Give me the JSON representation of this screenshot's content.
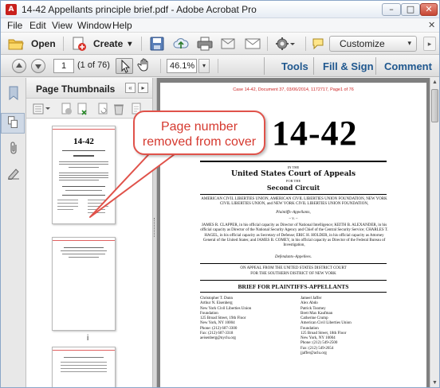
{
  "window": {
    "title": "14-42 Appellants principle brief.pdf - Adobe Acrobat Pro",
    "app_icon": "acrobat-icon",
    "controls": {
      "minimize": "–",
      "maximize": "□",
      "close": "✕"
    }
  },
  "menu": {
    "items": [
      "File",
      "Edit",
      "View",
      "Window",
      "Help"
    ],
    "close_glyph": "✕"
  },
  "toolbar": {
    "open_label": "Open",
    "create_label": "Create",
    "create_arrow": "▾",
    "customize_label": "Customize",
    "customize_arrow": "▾",
    "icons": [
      "open-folder-icon",
      "create-pdf-icon",
      "save-icon",
      "cloud-upload-icon",
      "print-icon",
      "email-icon",
      "gear-icon",
      "comment-icon"
    ]
  },
  "nav": {
    "page_value": "1",
    "page_of": "(1 of 76)",
    "zoom_value": "46.1%",
    "zoom_arrow": "▾",
    "tabs": [
      "Tools",
      "Fill & Sign",
      "Comment"
    ]
  },
  "thumbnails": {
    "title": "Page Thumbnails",
    "collapse_glyph": "«",
    "next_glyph": "▸",
    "page_labels": [
      "i"
    ],
    "thumb1_case": "14-42"
  },
  "callout": {
    "line1": "Page number",
    "line2": "removed from cover",
    "color": "#d5392f"
  },
  "document": {
    "header": "Case 14-42, Document 37, 03/06/2014, 1172717, Page1 of 76",
    "case_number": "14-42",
    "in_the": "IN THE",
    "court_line1": "United States Court of Appeals",
    "for_the": "FOR THE",
    "circuit": "Second Circuit",
    "parties": "AMERICAN CIVIL LIBERTIES UNION, AMERICAN CIVIL LIBERTIES UNION FOUNDATION, NEW YORK CIVIL LIBERTIES UNION, and NEW YORK CIVIL LIBERTIES UNION FOUNDATION,",
    "plaintiffs": "Plaintiffs–Appellants,",
    "v": "– v. –",
    "defendants_para": "JAMES R. CLAPPER, in his official capacity as Director of National Intelligence; KEITH B. ALEXANDER, in his official capacity as Director of the National Security Agency and Chief of the Central Security Service; CHARLES T. HAGEL, in his official capacity as Secretary of Defense; ERIC H. HOLDER, in his official capacity as Attorney General of the United States; and JAMES B. COMEY, in his official capacity as Director of the Federal Bureau of Investigation,",
    "defendants": "Defendants–Appellees.",
    "appeal1": "ON APPEAL FROM THE UNITED STATES DISTRICT COURT",
    "appeal2": "FOR THE SOUTHERN DISTRICT OF NEW YORK",
    "brief_title": "BRIEF FOR PLAINTIFFS-APPELLANTS",
    "counsel_left": [
      "Christopher T. Dunn",
      "Arthur N. Eisenberg",
      "New York Civil Liberties Union",
      "  Foundation",
      "125 Broad Street, 19th Floor",
      "New York, NY 10004",
      "Phone: (212) 607-3300",
      "Fax: (212) 607-3318",
      "aeisenberg@nyclu.org"
    ],
    "counsel_right": [
      "Jameel Jaffer",
      "Alex Abdo",
      "Patrick Toomey",
      "Brett Max Kaufman",
      "Catherine Crump",
      "American Civil Liberties Union",
      "  Foundation",
      "125 Broad Street, 18th Floor",
      "New York, NY 10004",
      "Phone: (212) 549-2500",
      "Fax: (212) 549-2654",
      "jjaffer@aclu.org"
    ]
  }
}
